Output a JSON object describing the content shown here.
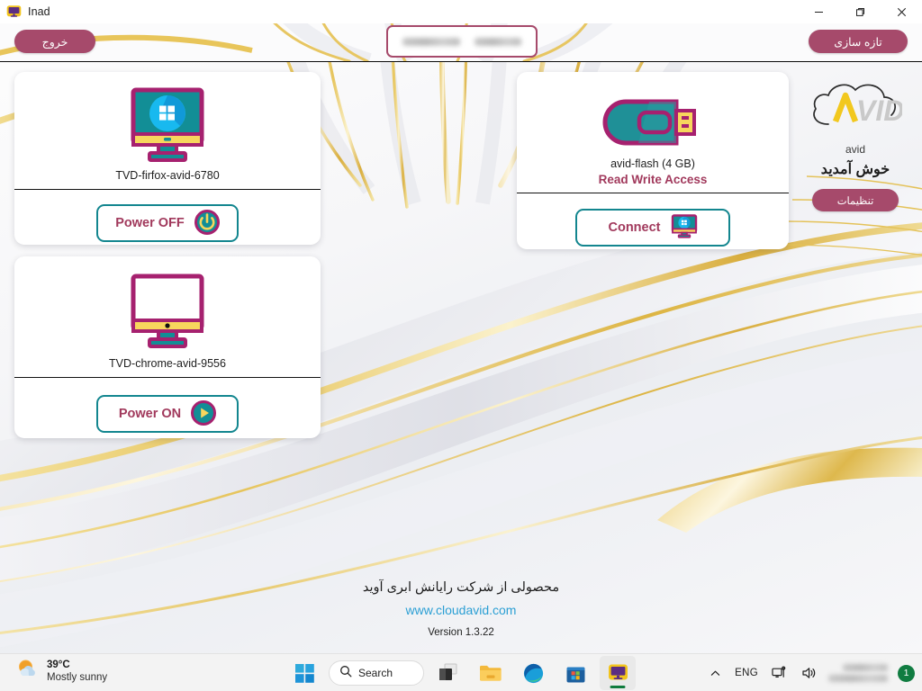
{
  "window": {
    "title": "Inad",
    "app_icon": "monitor-icon",
    "minimize_label": "Minimize",
    "maximize_label": "Maximize",
    "close_label": "Close"
  },
  "header": {
    "exit_label": "خروج",
    "refresh_label": "تازه سازی",
    "host_field": {
      "redacted": true,
      "value_1": "",
      "value_2": ""
    }
  },
  "vm_cards": [
    {
      "name": "TVD-firfox-avid-6780",
      "icon": "windows-monitor-icon",
      "powered_on": true,
      "action_label": "Power OFF",
      "action_icon": "power-icon"
    },
    {
      "name": "TVD-chrome-avid-9556",
      "icon": "blank-monitor-icon",
      "powered_on": false,
      "action_label": "Power ON",
      "action_icon": "play-icon"
    }
  ],
  "usb_card": {
    "name": "avid-flash  (4 GB)",
    "access": "Read Write Access",
    "icon": "usb-flash-icon",
    "action_label": "Connect",
    "action_icon": "monitor-windows-small-icon"
  },
  "brand": {
    "logo": "avid-cloud-logo",
    "name": "avid",
    "welcome": "خوش آمدید",
    "settings_label": "تنظیمات"
  },
  "footer": {
    "tagline": "محصولی از شرکت رایانش ابری آوید",
    "url": "www.cloudavid.com",
    "version": "Version 1.3.22"
  },
  "taskbar": {
    "weather": {
      "icon": "partly-sunny-icon",
      "temperature": "39°C",
      "condition": "Mostly sunny"
    },
    "start_label": "Start",
    "search_label": "Search",
    "search_icon": "search-icon",
    "items": [
      {
        "name": "task-view",
        "icon": "task-view-icon"
      },
      {
        "name": "file-explorer",
        "icon": "folder-icon"
      },
      {
        "name": "microsoft-edge",
        "icon": "edge-icon"
      },
      {
        "name": "microsoft-store",
        "icon": "store-icon"
      },
      {
        "name": "inad-app",
        "icon": "monitor-icon",
        "active": true
      }
    ],
    "tray": {
      "overflow_icon": "chevron-up-icon",
      "language": "ENG",
      "network_icon": "network-icon",
      "volume_icon": "volume-icon",
      "clock_redacted": true,
      "badge_count": "1"
    }
  },
  "colors": {
    "accent_magenta": "#a64a6b",
    "accent_teal": "#13868f",
    "accent_maroon": "#a1395c",
    "accent_gold": "#e8c55a",
    "accent_yellow": "#f7d65d",
    "link_blue": "#2b9fd4"
  }
}
